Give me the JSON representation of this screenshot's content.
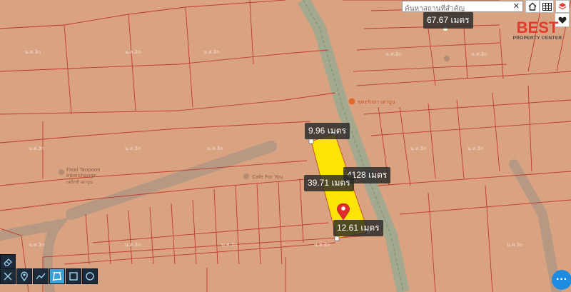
{
  "search": {
    "placeholder": "ค้นหาสถานที่สำคัญ",
    "clear_icon": "close-icon"
  },
  "top_buttons": [
    {
      "icon": "home-icon"
    },
    {
      "icon": "grid-icon"
    },
    {
      "icon": "layers-icon"
    }
  ],
  "side_buttons": [
    {
      "icon": "heart-icon"
    }
  ],
  "logo": {
    "line1": "BEST",
    "line2": "PROPERTY CENTER",
    "color": "#e23a2b"
  },
  "measurements": {
    "top_right": "67.67 เมตร",
    "top_edge": "9.96 เมตร",
    "right_edge": "4128 เมตร",
    "left_edge": "39.71 เมตร",
    "bottom_edge": "12.61 เมตร"
  },
  "pois": {
    "flexi": "Flexi Taopoon Interchange",
    "flexi_sub": "เฟล็กซี่ เตาปูน",
    "coffee": "Cafe For You",
    "red_poi": "พุทธรักษา เตาปูน"
  },
  "colors": {
    "map_bg": "#d9a381",
    "parcel_line": "#c0392b",
    "highlight": "#ffe800",
    "road": "#b39a88",
    "rail": "#8fae9a"
  },
  "tools": [
    {
      "icon": "measure-icon",
      "active": false
    },
    {
      "icon": "pin-icon",
      "active": false
    },
    {
      "icon": "route-icon",
      "active": false
    },
    {
      "icon": "polygon-icon",
      "active": true
    },
    {
      "icon": "rectangle-icon",
      "active": false
    },
    {
      "icon": "circle-icon",
      "active": false
    }
  ],
  "eraser": {
    "icon": "eraser-icon"
  },
  "fab": {
    "icon": "more-icon",
    "text": "···"
  }
}
